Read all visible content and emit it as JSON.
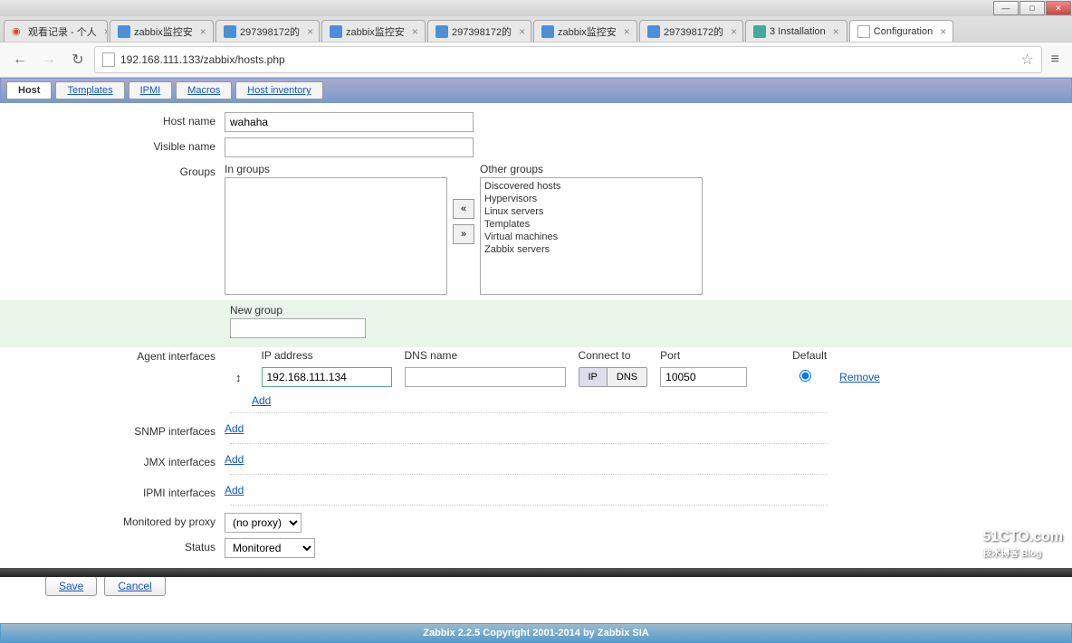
{
  "window": {
    "minimize": "—",
    "maximize": "□",
    "close": "✕"
  },
  "browser_tabs": [
    {
      "title": "观看记录 - 个人"
    },
    {
      "title": "zabbix监控安"
    },
    {
      "title": "297398172的"
    },
    {
      "title": "zabbix监控安"
    },
    {
      "title": "297398172的"
    },
    {
      "title": "zabbix监控安"
    },
    {
      "title": "297398172的"
    },
    {
      "title": "3 Installation"
    },
    {
      "title": "Configuration"
    }
  ],
  "url": "192.168.111.133/zabbix/hosts.php",
  "form_tabs": [
    {
      "label": "Host",
      "active": true
    },
    {
      "label": "Templates"
    },
    {
      "label": "IPMI"
    },
    {
      "label": "Macros"
    },
    {
      "label": "Host inventory"
    }
  ],
  "labels": {
    "host_name": "Host name",
    "visible_name": "Visible name",
    "groups": "Groups",
    "in_groups": "In groups",
    "other_groups": "Other groups",
    "new_group": "New group",
    "agent_interfaces": "Agent interfaces",
    "snmp_interfaces": "SNMP interfaces",
    "jmx_interfaces": "JMX interfaces",
    "ipmi_interfaces": "IPMI interfaces",
    "monitored_by_proxy": "Monitored by proxy",
    "status": "Status",
    "ip_address": "IP address",
    "dns_name": "DNS name",
    "connect_to": "Connect to",
    "port": "Port",
    "default": "Default"
  },
  "values": {
    "host_name": "wahaha",
    "visible_name": "",
    "new_group": "",
    "agent_ip": "192.168.111.134",
    "agent_dns": "",
    "agent_port": "10050",
    "proxy": "(no proxy)",
    "status": "Monitored"
  },
  "other_groups": [
    "Discovered hosts",
    "Hypervisors",
    "Linux servers",
    "Templates",
    "Virtual machines",
    "Zabbix servers"
  ],
  "toggle": {
    "ip": "IP",
    "dns": "DNS"
  },
  "actions": {
    "add": "Add",
    "remove": "Remove",
    "save": "Save",
    "cancel": "Cancel",
    "move_left": "«",
    "move_right": "»"
  },
  "footer": "Zabbix 2.2.5 Copyright 2001-2014 by Zabbix SIA",
  "watermark": {
    "main": "51CTO.com",
    "sub": "技术博客  Blog"
  }
}
